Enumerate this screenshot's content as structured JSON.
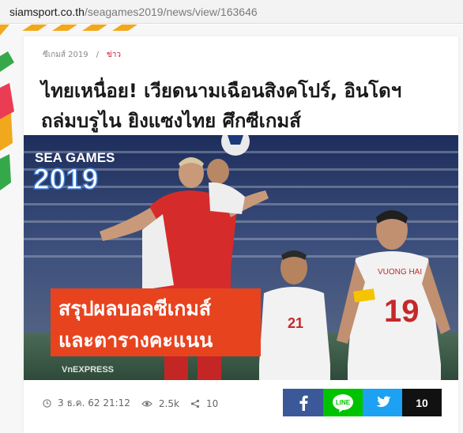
{
  "browser": {
    "url_host": "siamsport.co.th",
    "url_path": "/seagames2019/news/view/163646"
  },
  "breadcrumb": {
    "section": "ซีเกมส์ 2019",
    "separator": "/",
    "category": "ข่าว"
  },
  "article": {
    "title_line1": "ไทยเหนื่อย! เวียดนามเฉือนสิงคโปร์, อินโดฯ",
    "title_line2": "ถล่มบรูไน ยิงแซงไทย ศึกซีเกมส์"
  },
  "hero": {
    "logo_top": "SEA GAMES",
    "logo_year": "2019",
    "banner_line1": "สรุปผลบอลซีเกมส์",
    "banner_line2": "และตารางคะแนน",
    "watermark": "VnEXPRESS",
    "jersey_number_left": "21",
    "jersey_number_right": "19",
    "jersey_name": "VUONG HAI",
    "colors": {
      "banner": "#e8431f",
      "singapore_kit": "#d62b2b",
      "vietnam_kit": "#f2f2f2"
    }
  },
  "meta": {
    "date": "3 ธ.ค. 62  21:12",
    "views": "2.5k",
    "shares": "10"
  },
  "share_bar": {
    "facebook_icon": "facebook-icon",
    "line_label": "LINE",
    "twitter_icon": "twitter-icon",
    "count": "10",
    "colors": {
      "facebook": "#3b5998",
      "line": "#00c300",
      "twitter": "#1da1f2",
      "count": "#111111"
    }
  }
}
